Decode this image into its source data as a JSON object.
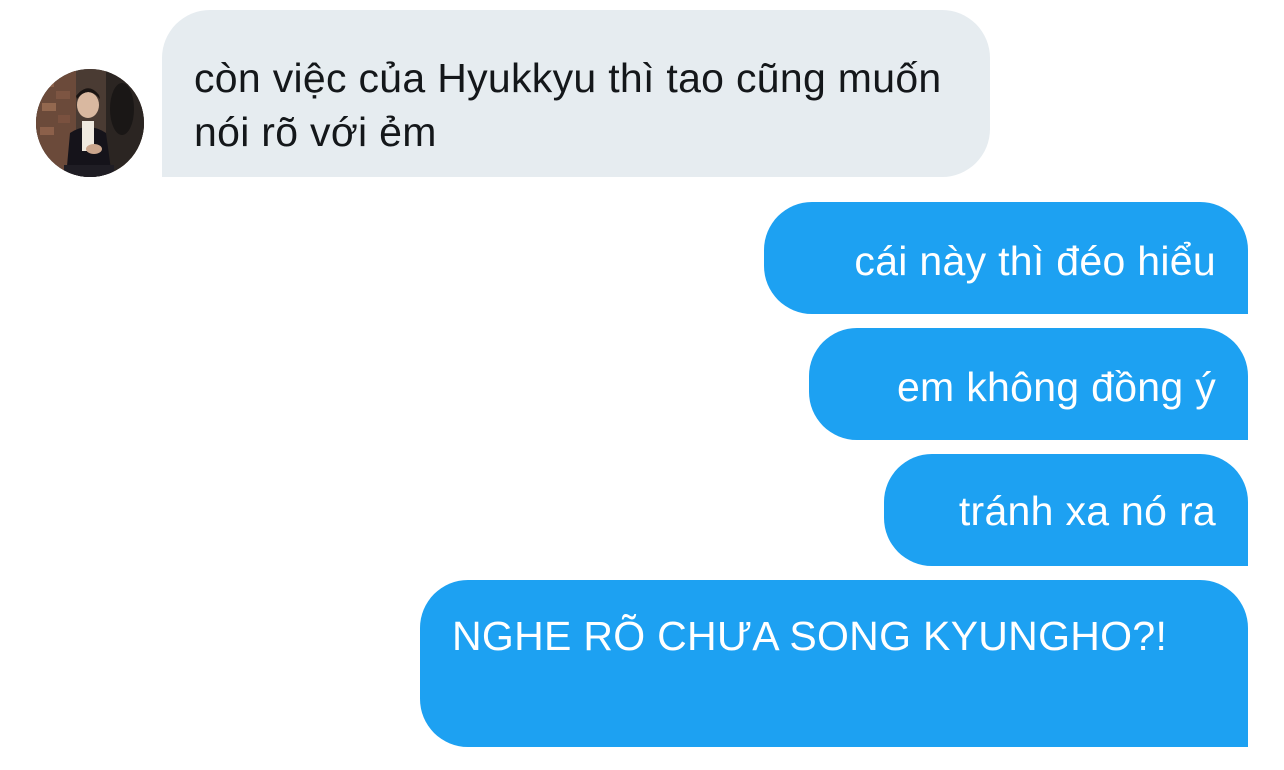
{
  "conversation": {
    "messages": [
      {
        "direction": "incoming",
        "text": "còn việc của Hyukkyu thì tao cũng muốn nói rõ với ẻm"
      },
      {
        "direction": "outgoing",
        "text": "cái này thì đéo hiểu"
      },
      {
        "direction": "outgoing",
        "text": "em không đồng ý"
      },
      {
        "direction": "outgoing",
        "text": "tránh xa nó ra"
      },
      {
        "direction": "outgoing",
        "text": "NGHE RÕ CHƯA SONG KYUNGHO?!"
      }
    ]
  },
  "colors": {
    "incoming_bubble": "#e6ecf0",
    "outgoing_bubble": "#1da1f2",
    "incoming_text": "#14171a",
    "outgoing_text": "#ffffff"
  },
  "icons": {
    "avatar": "user-photo-avatar"
  }
}
